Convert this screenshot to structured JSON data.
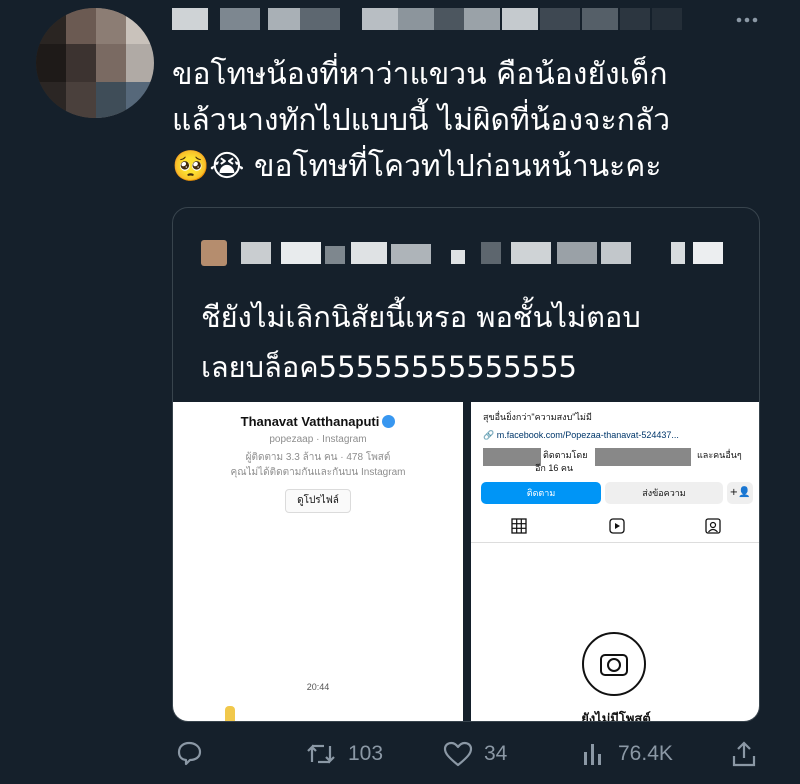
{
  "tweet": {
    "text": "ขอโทษน้องที่หาว่าแขวน คือน้องยังเด็ก\nแล้วนางทักไปแบบนี้ ไม่ผิดที่น้องจะกลัว\n🥺😭 ขอโทษที่โควทไปก่อนหน้านะคะ"
  },
  "quote": {
    "text": "ชียังไม่เลิกนิสัยนี้เหรอ พอชั้นไม่ตอบ\nเลยบล็อค55555555555555"
  },
  "screenshot_left": {
    "name": "Thanavat Vatthanaputi",
    "handle": "popezaap · Instagram",
    "stats": "ผู้ติดตาม 3.3 ล้าน คน · 478 โพสต์",
    "note": "คุณไม่ได้ติดตามกันและกันบน Instagram",
    "button": "ดูโปรไฟล์",
    "time": "20:44"
  },
  "screenshot_right": {
    "bio": "สุขอื่นยิ่งกว่า\"ความสงบ\"ไม่มี",
    "link": "m.facebook.com/Popezaa-thanavat-524437...",
    "followed_by_prefix": "ติดตามโดย",
    "followed_by_suffix": "และคนอื่นๆ",
    "followed_by_count": "อีก 16 คน",
    "follow_button": "ติดตาม",
    "message_button": "ส่งข้อความ",
    "no_posts": "ยังไม่มีโพสต์"
  },
  "actions": {
    "retweets": "103",
    "likes": "34",
    "views": "76.4K"
  },
  "colors": {
    "background": "#15202b",
    "muted": "#8b98a5",
    "border": "#38444d",
    "ig_blue": "#0095f6"
  }
}
